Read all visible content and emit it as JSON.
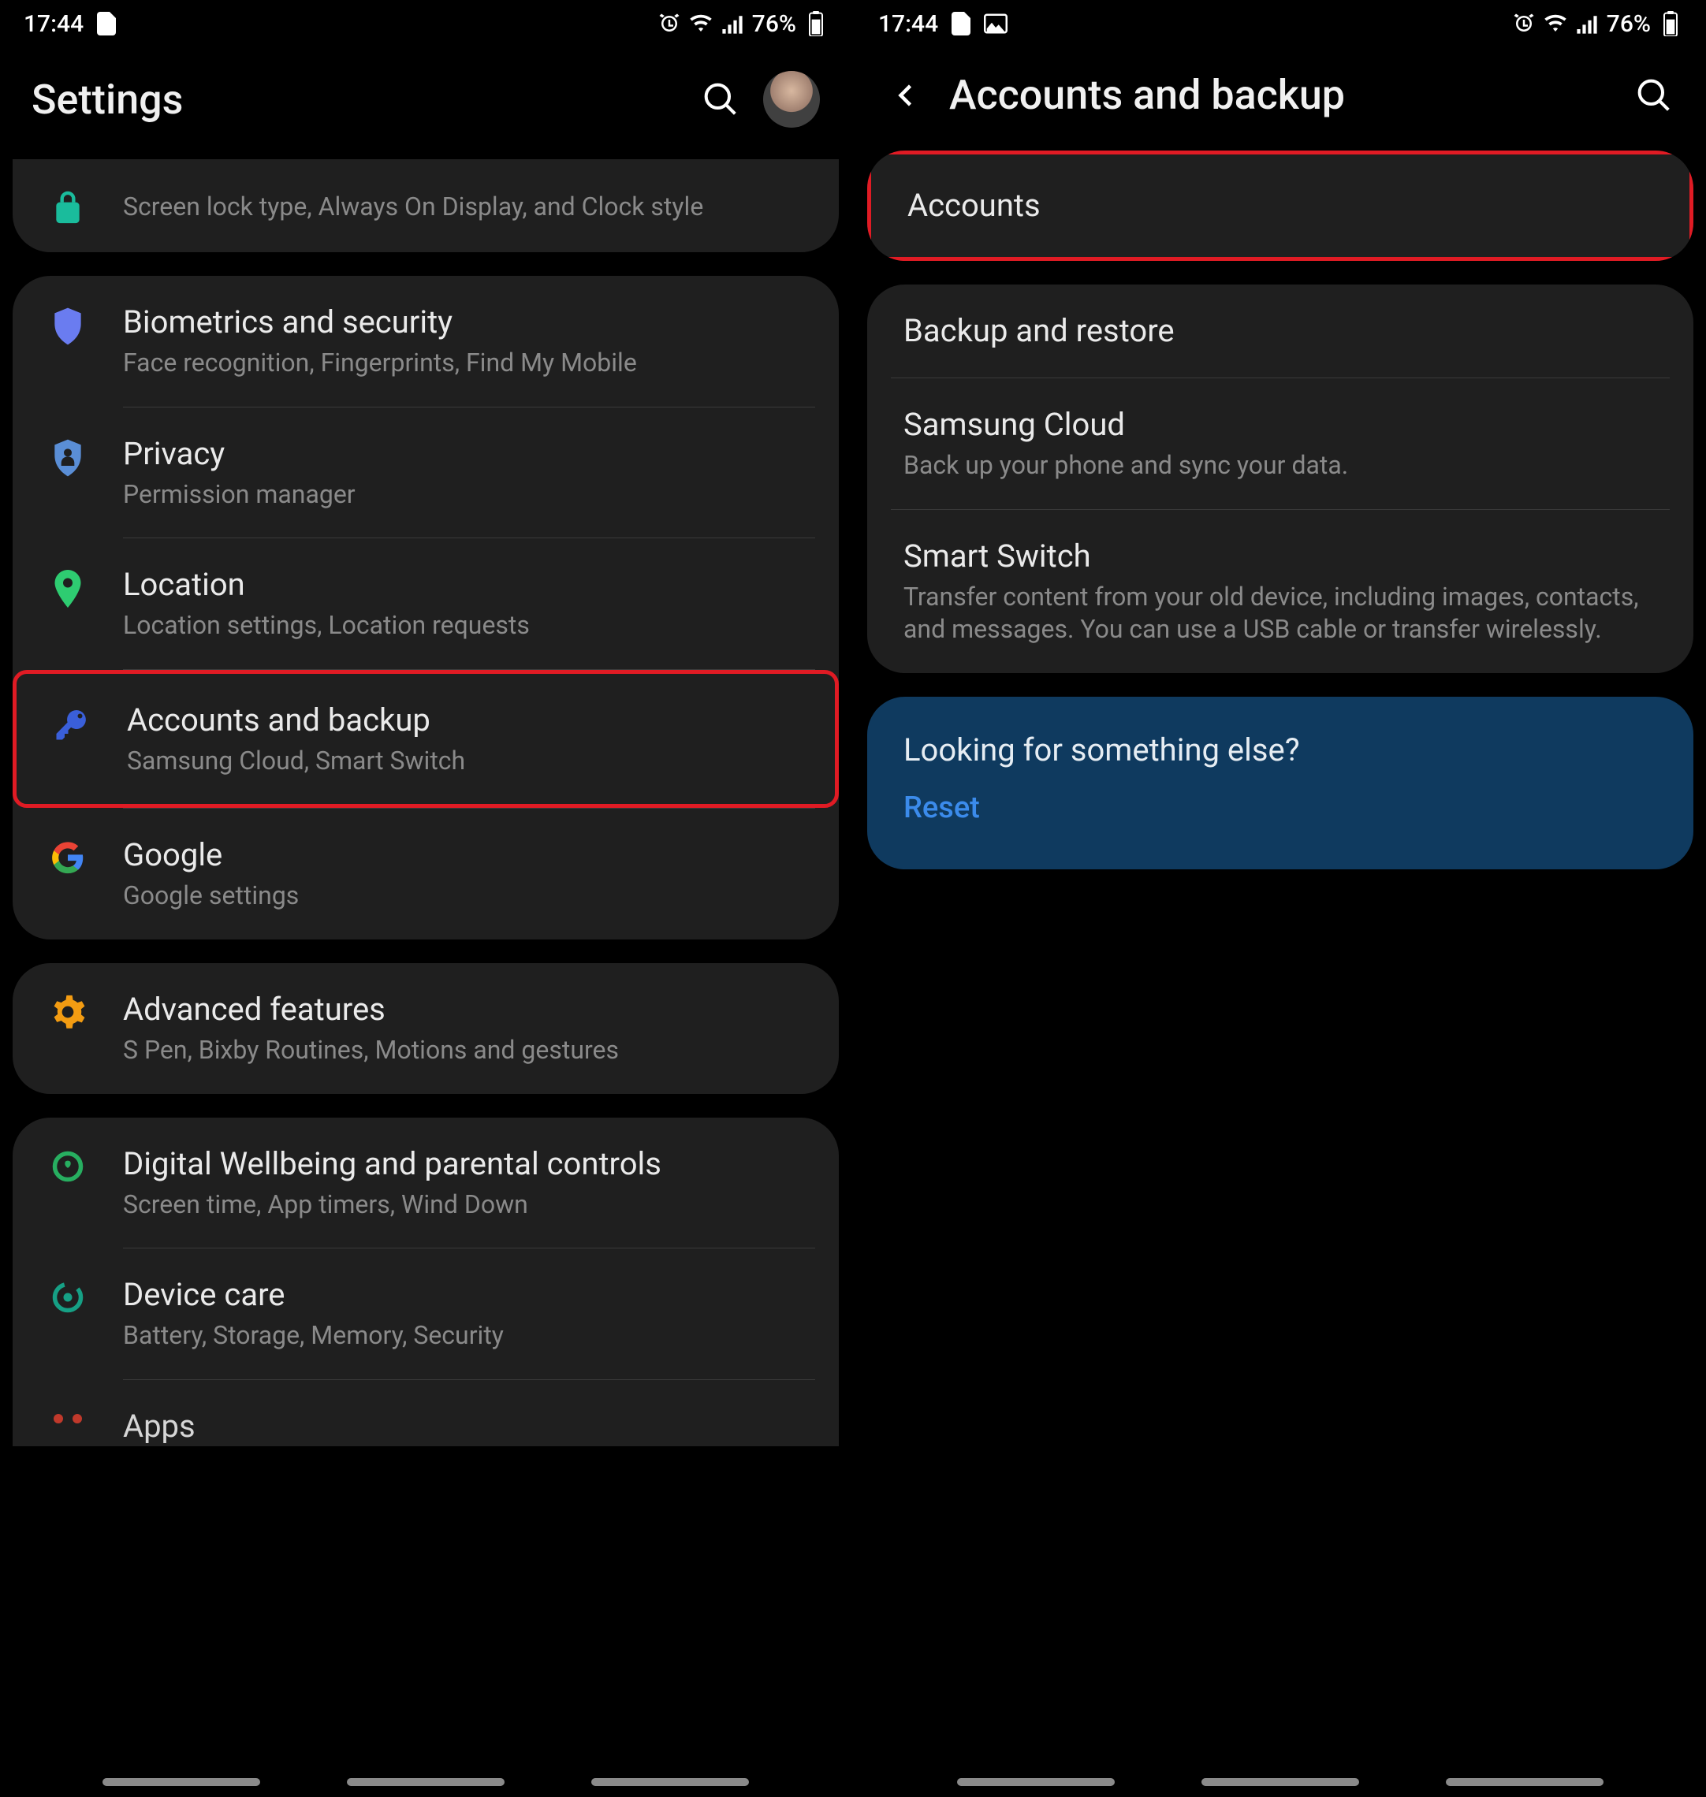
{
  "status": {
    "time": "17:44",
    "battery": "76%"
  },
  "left": {
    "title": "Settings",
    "partial": {
      "sub": "Screen lock type, Always On Display, and Clock style"
    },
    "group1": [
      {
        "icon": "shield",
        "title": "Biometrics and security",
        "sub": "Face recognition, Fingerprints, Find My Mobile"
      },
      {
        "icon": "privacy",
        "title": "Privacy",
        "sub": "Permission manager"
      },
      {
        "icon": "location",
        "title": "Location",
        "sub": "Location settings, Location requests"
      },
      {
        "icon": "key",
        "title": "Accounts and backup",
        "sub": "Samsung Cloud, Smart Switch",
        "hl": true
      },
      {
        "icon": "google",
        "title": "Google",
        "sub": "Google settings"
      }
    ],
    "group2": [
      {
        "icon": "gear",
        "title": "Advanced features",
        "sub": "S Pen, Bixby Routines, Motions and gestures"
      }
    ],
    "group3": [
      {
        "icon": "wellbeing",
        "title": "Digital Wellbeing and parental controls",
        "sub": "Screen time, App timers, Wind Down"
      },
      {
        "icon": "devicecare",
        "title": "Device care",
        "sub": "Battery, Storage, Memory, Security"
      },
      {
        "icon": "apps",
        "title": "Apps",
        "sub": ""
      }
    ]
  },
  "right": {
    "title": "Accounts and backup",
    "group1": [
      {
        "title": "Accounts",
        "sub": "",
        "hl": true
      }
    ],
    "group2": [
      {
        "title": "Backup and restore",
        "sub": ""
      },
      {
        "title": "Samsung Cloud",
        "sub": "Back up your phone and sync your data."
      },
      {
        "title": "Smart Switch",
        "sub": "Transfer content from your old device, including images, contacts, and messages. You can use a USB cable or transfer wirelessly."
      }
    ],
    "lookup": {
      "title": "Looking for something else?",
      "link": "Reset"
    }
  }
}
